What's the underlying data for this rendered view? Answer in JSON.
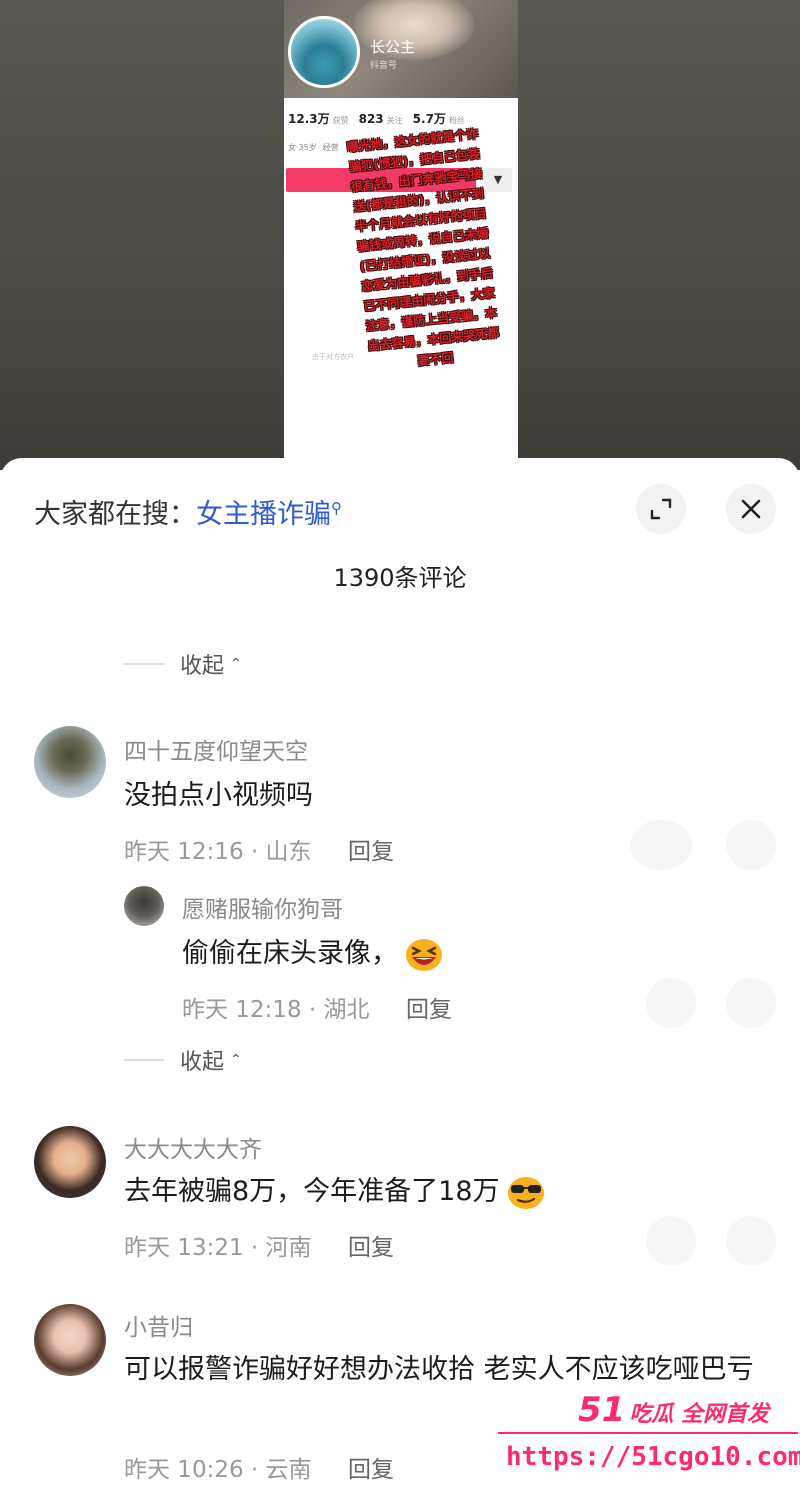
{
  "video": {
    "profile_name": "长公主",
    "profile_sub": "抖音号",
    "stats": [
      {
        "value": "12.3万",
        "label": "获赞"
      },
      {
        "value": "823",
        "label": "关注"
      },
      {
        "value": "5.7万",
        "label": "粉丝"
      }
    ],
    "tags": [
      "女·35岁",
      "经营"
    ],
    "dropdown": "▼",
    "faint_text": "由于对方农户",
    "scam_note": "曝光她，这女的就是个诈骗犯(惯犯)，把自己包装很有钱，出门奔驰宝马接送(都是租的)，认识不到半个月就会以有好的项目骗钱或周转，说自己未婚(已打结婚证)，没谈过以恋爱为由骗彩礼，到手后已不同理由闹分手，大家注意，谨防上当受骗，本出去容易，本回来哭死都要不回"
  },
  "sheet": {
    "search_prefix": "大家都在搜：",
    "search_keyword": "女主播诈骗",
    "comment_count": "1390条评论",
    "collapse_label": "收起",
    "reply_label": "回复"
  },
  "comments": [
    {
      "user": "四十五度仰望天空",
      "text": "没拍点小视频吗",
      "time": "昨天 12:16 · 山东"
    },
    {
      "user": "愿赌服输你狗哥",
      "text": "偷偷在床头录像，",
      "time": "昨天 12:18 · 湖北"
    },
    {
      "user": "大大大大大齐",
      "text": "去年被骗8万，今年准备了18万",
      "time": "昨天 13:21 · 河南"
    },
    {
      "user": "小昔归",
      "text": "可以报警诈骗好好想办法收拾   老实人不应该吃哑巴亏",
      "time": "昨天 10:26 · 云南"
    }
  ],
  "watermark": {
    "logo": "51",
    "logo_text": "吃瓜 全网首发",
    "url": "https://51cgo10.com"
  },
  "colors": {
    "keyword": "#2f5bd3",
    "watermark": "#ff2a6d",
    "scam_red": "#d6212a"
  }
}
